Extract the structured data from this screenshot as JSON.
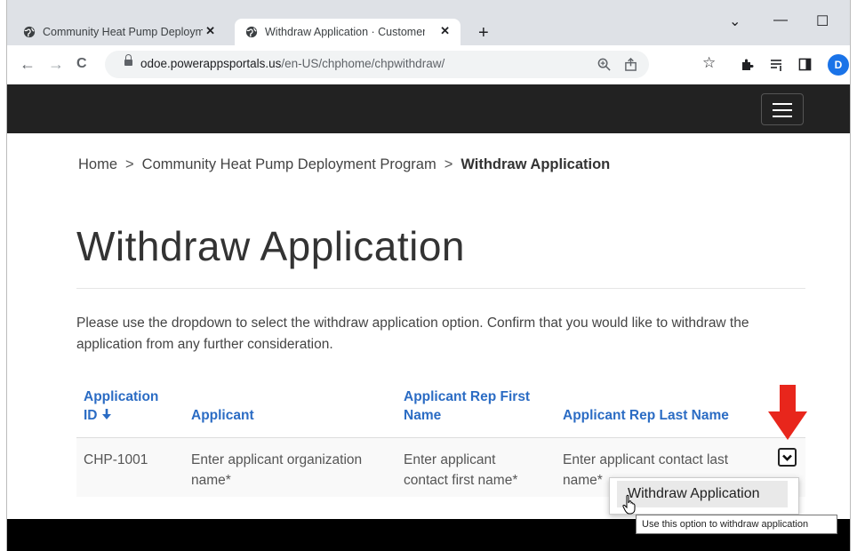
{
  "browser": {
    "tabs": [
      {
        "title": "Community Heat Pump Deployme",
        "close": "✕"
      },
      {
        "title": "Withdraw Application · Customer",
        "close": "✕"
      }
    ],
    "new_tab": "+",
    "window_controls": {
      "chevron": "⌄",
      "minimize": "—",
      "maximize": "☐"
    },
    "nav": {
      "back": "←",
      "forward": "→",
      "reload": "C"
    },
    "url_host": "odoe.powerappsportals.us",
    "url_path": "/en-US/chphome/chpwithdraw/",
    "profile_initial": "D",
    "icons": [
      "zoom-icon",
      "share-icon",
      "star-icon",
      "extensions-icon",
      "reading-list-icon",
      "side-panel-icon"
    ]
  },
  "breadcrumb": {
    "home": "Home",
    "separator": ">",
    "parent": "Community Heat Pump Deployment Program",
    "current": "Withdraw Application"
  },
  "page": {
    "title": "Withdraw Application",
    "intro": "Please use the dropdown to select the withdraw application option.  Confirm that you would like to withdraw the application from any further consideration."
  },
  "table": {
    "headers": {
      "id_line1": "Application",
      "id_line2": "ID",
      "sort_icon": "🡫",
      "applicant": "Applicant",
      "rep_first_line1": "Applicant Rep First",
      "rep_first_line2": "Name",
      "rep_last": "Applicant Rep Last Name"
    },
    "row": {
      "id": "CHP-1001",
      "applicant_line1": "Enter applicant organization",
      "applicant_line2": "name*",
      "rep_first_line1": "Enter applicant",
      "rep_first_line2": "contact first name*",
      "rep_last_line1": "Enter applicant contact last",
      "rep_last_line2": "name*"
    }
  },
  "dropdown": {
    "item": "Withdraw Application",
    "tooltip": "Use this option to withdraw application"
  },
  "colors": {
    "header_link": "#2b6cc4",
    "arrow": "#e8261c",
    "site_header": "#222222"
  }
}
